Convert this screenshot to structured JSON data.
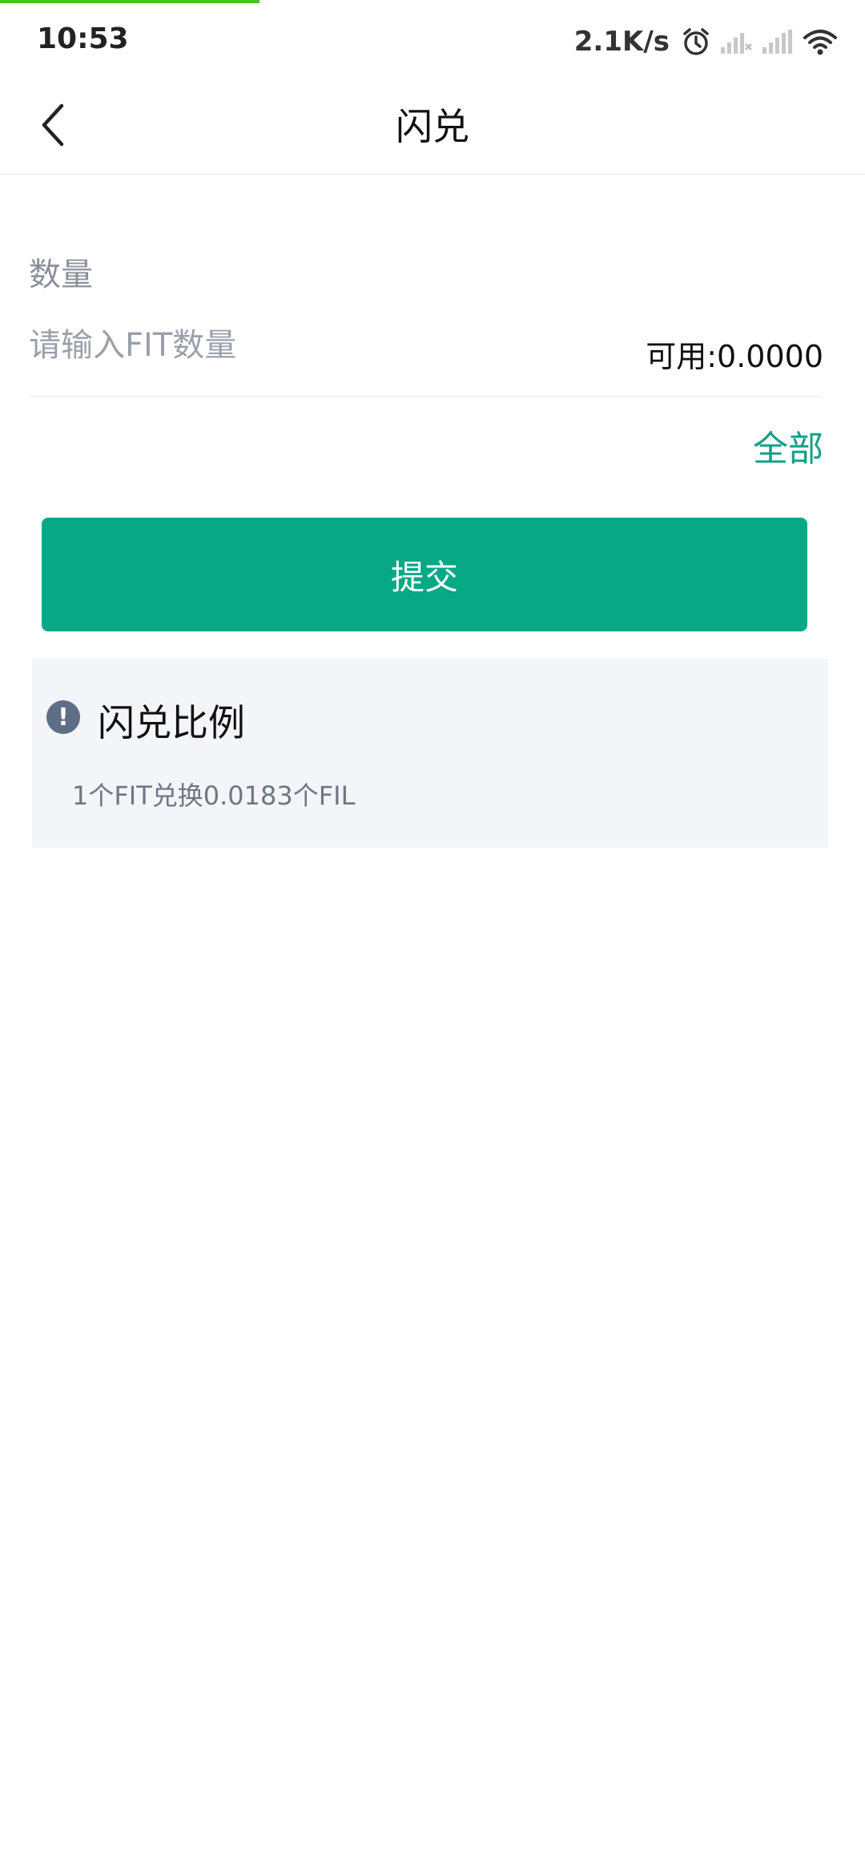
{
  "status_bar": {
    "time": "10:53",
    "net_speed": "2.1K/s",
    "icons": [
      "alarm-icon",
      "signal-icon",
      "signal-icon",
      "wifi-icon"
    ]
  },
  "nav": {
    "title": "闪兑",
    "back_icon": "chevron-left-icon"
  },
  "form": {
    "quantity_label": "数量",
    "quantity_placeholder": "请输入FIT数量",
    "quantity_value": "",
    "available_label": "可用:",
    "available_value": "0.0000",
    "all_label": "全部",
    "submit_label": "提交"
  },
  "info": {
    "icon": "info-icon",
    "icon_glyph": "!",
    "title": "闪兑比例",
    "rate_text": "1个FIT兑换0.0183个FIL"
  },
  "colors": {
    "accent": "#07a886",
    "link": "#12a084",
    "progress": "#4cc21c",
    "info_icon_bg": "#5e6e86",
    "card_bg": "#f4f5f9"
  }
}
